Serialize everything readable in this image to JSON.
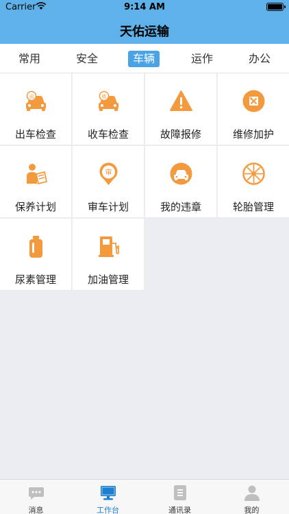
{
  "status_bar": {
    "carrier": "Carrier",
    "time": "9:14 AM"
  },
  "header": {
    "title": "天佑运输"
  },
  "tabs": [
    {
      "label": "常用",
      "active": false
    },
    {
      "label": "安全",
      "active": false
    },
    {
      "label": "车辆",
      "active": true
    },
    {
      "label": "运作",
      "active": false
    },
    {
      "label": "办公",
      "active": false
    }
  ],
  "grid": [
    {
      "label": "出车检查",
      "icon": "car-out-icon"
    },
    {
      "label": "收车检查",
      "icon": "car-return-icon"
    },
    {
      "label": "故障报修",
      "icon": "warning-icon"
    },
    {
      "label": "维修加护",
      "icon": "repair-tools-icon"
    },
    {
      "label": "保养计划",
      "icon": "maintenance-person-icon"
    },
    {
      "label": "审车计划",
      "icon": "inspection-badge-icon"
    },
    {
      "label": "我的违章",
      "icon": "violation-car-icon"
    },
    {
      "label": "轮胎管理",
      "icon": "tire-icon"
    },
    {
      "label": "尿素管理",
      "icon": "urea-bottle-icon"
    },
    {
      "label": "加油管理",
      "icon": "fuel-pump-icon"
    }
  ],
  "tab_bar": [
    {
      "label": "消息",
      "icon": "message-icon",
      "active": false
    },
    {
      "label": "工作台",
      "icon": "workbench-icon",
      "active": true
    },
    {
      "label": "通讯录",
      "icon": "contacts-icon",
      "active": false
    },
    {
      "label": "我的",
      "icon": "profile-icon",
      "active": false
    }
  ],
  "colors": {
    "header": "#5fb1ea",
    "accent": "#f39a3f",
    "active_tab": "#4aa3e4",
    "tabbar_active": "#1f7fcf"
  }
}
